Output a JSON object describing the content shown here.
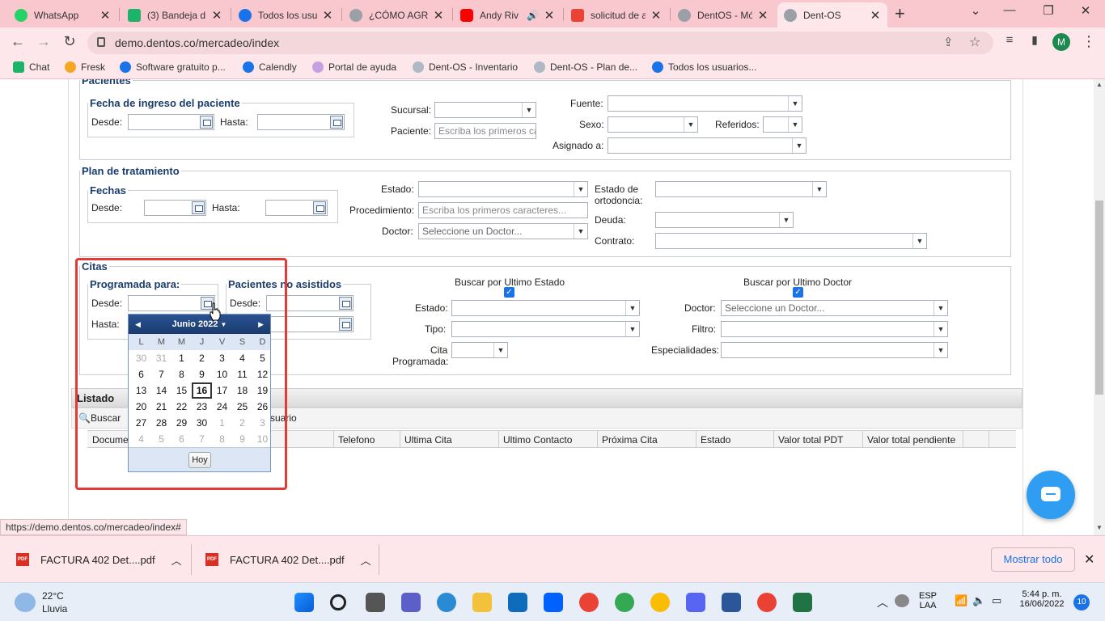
{
  "browser": {
    "tabs": [
      {
        "title": "WhatsApp",
        "color": "#25d366"
      },
      {
        "title": "(3) Bandeja d",
        "color": "#1db46a"
      },
      {
        "title": "Todos los usu",
        "color": "#1a73e8"
      },
      {
        "title": "¿CÓMO AGRE",
        "color": "#9aa0a6"
      },
      {
        "title": "Andy Riv",
        "color": "#ff0000"
      },
      {
        "title": "solicitud de a",
        "color": "#ea4335"
      },
      {
        "title": "DentOS - Mó",
        "color": "#9aa0a6"
      },
      {
        "title": "Dent-OS",
        "color": "#9aa0a6"
      }
    ],
    "url": "demo.dentos.co/mercadeo/index",
    "profile_initial": "M",
    "bookmarks": [
      "Chat",
      "Fresk",
      "Software gratuito p...",
      "Calendly",
      "Portal de ayuda",
      "Dent-OS - Inventario",
      "Dent-OS - Plan de...",
      "Todos los usuarios..."
    ]
  },
  "pacientes": {
    "legend": "Pacientes",
    "fecha_legend": "Fecha de ingreso del paciente",
    "desde": "Desde:",
    "hasta": "Hasta:",
    "sucursal": "Sucursal:",
    "paciente": "Paciente:",
    "paciente_placeholder": "Escriba los primeros ca",
    "fuente": "Fuente:",
    "sexo": "Sexo:",
    "referidos": "Referidos:",
    "asignado": "Asignado a:"
  },
  "plan": {
    "legend": "Plan de tratamiento",
    "fechas_legend": "Fechas",
    "desde": "Desde:",
    "hasta": "Hasta:",
    "estado": "Estado:",
    "procedimiento": "Procedimiento:",
    "procedimiento_placeholder": "Escriba los primeros caracteres...",
    "doctor": "Doctor:",
    "doctor_placeholder": "Seleccione un Doctor...",
    "estado_ortodoncia_1": "Estado de",
    "estado_ortodoncia_2": "ortodoncia:",
    "deuda": "Deuda:",
    "contrato": "Contrato:"
  },
  "citas": {
    "legend": "Citas",
    "programada_legend": "Programada para:",
    "no_asistidos_legend": "Pacientes no asistidos",
    "desde": "Desde:",
    "hasta": "Hasta:",
    "desde2": "Desde:",
    "buscar_estado": "Buscar por Ultimo Estado",
    "buscar_doctor": "Buscar por Ultimo Doctor",
    "estado": "Estado:",
    "tipo": "Tipo:",
    "cita_prog_1": "Cita",
    "cita_prog_2": "Programada:",
    "doctor": "Doctor:",
    "doctor_placeholder": "Seleccione un Doctor...",
    "filtro": "Filtro:",
    "especialidades": "Especialidades:"
  },
  "listado": {
    "title": "Listado",
    "buscar": "Buscar",
    "usuario_fragment": "suario",
    "columns": [
      "Docume",
      "Telefono",
      "Ultima Cita",
      "Ultimo Contacto",
      "Próxima Cita",
      "Estado",
      "Valor total PDT",
      "Valor total pendiente"
    ]
  },
  "datepicker": {
    "month_label": "Junio 2022",
    "dow": [
      "L",
      "M",
      "M",
      "J",
      "V",
      "S",
      "D"
    ],
    "weeks": [
      [
        "30",
        "31",
        "1",
        "2",
        "3",
        "4",
        "5"
      ],
      [
        "6",
        "7",
        "8",
        "9",
        "10",
        "11",
        "12"
      ],
      [
        "13",
        "14",
        "15",
        "16",
        "17",
        "18",
        "19"
      ],
      [
        "20",
        "21",
        "22",
        "23",
        "24",
        "25",
        "26"
      ],
      [
        "27",
        "28",
        "29",
        "30",
        "1",
        "2",
        "3"
      ],
      [
        "4",
        "5",
        "6",
        "7",
        "8",
        "9",
        "10"
      ]
    ],
    "today": "16",
    "today_button": "Hoy"
  },
  "status_url": "https://demo.dentos.co/mercadeo/index#",
  "downloads": {
    "items": [
      "FACTURA 402  Det....pdf",
      "FACTURA 402  Det....pdf"
    ],
    "show_all": "Mostrar todo"
  },
  "taskbar": {
    "weather_temp": "22°C",
    "weather_desc": "Lluvia",
    "lang_1": "ESP",
    "lang_2": "LAA",
    "time": "5:44 p. m.",
    "date": "16/06/2022",
    "notifications": "10"
  }
}
